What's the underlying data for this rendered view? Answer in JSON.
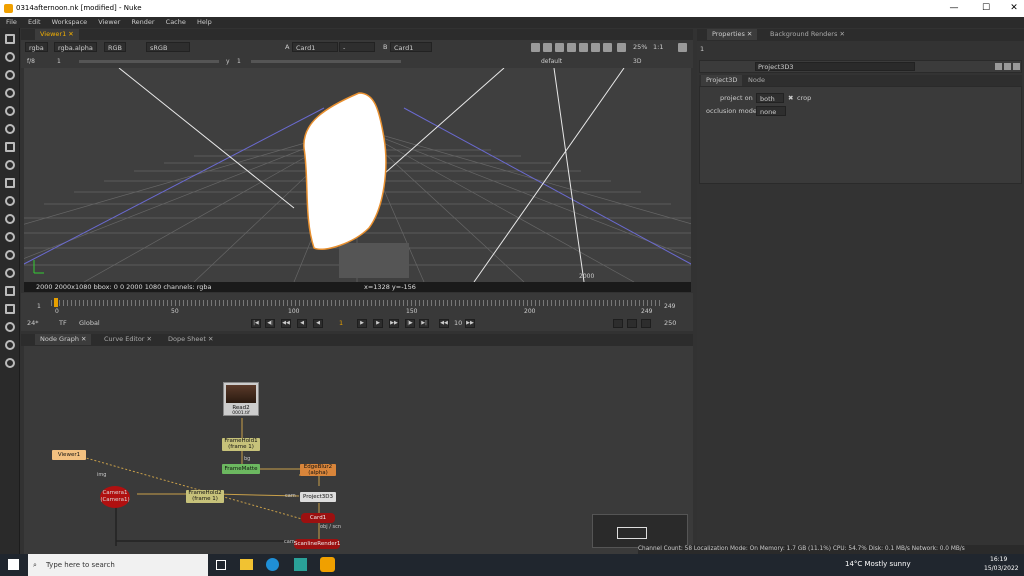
{
  "window": {
    "title": "0314afternoon.nk [modified] - Nuke"
  },
  "menu": [
    "File",
    "Edit",
    "Workspace",
    "Viewer",
    "Render",
    "Cache",
    "Help"
  ],
  "viewer": {
    "tab": "Viewer1",
    "channels": "rgba",
    "alpha": "rgba.alpha",
    "colorspace_a": "RGB",
    "colorspace_b": "sRGB",
    "input_a_label": "A",
    "input_a": "Card1",
    "input_a_op": "-",
    "input_b_label": "B",
    "input_b": "Card1",
    "zoom": "25%",
    "ratio": "1:1",
    "fstop": "f/8",
    "frame": "1",
    "y_label": "y",
    "y_value": "1",
    "camera": "default",
    "mode": "3D",
    "info_left": "2000  2000x1080  bbox: 0 0 2000 1080 channels: rgba",
    "info_coords": "x=1328 y=-156",
    "scene_label": "2000"
  },
  "timeline": {
    "ticks": [
      "0",
      "50",
      "100",
      "150",
      "200",
      "249"
    ],
    "start": "1",
    "end": "249",
    "current": "1",
    "fps": "24*",
    "tf": "TF",
    "global": "Global",
    "step": "10",
    "end_frame": "250"
  },
  "tabs_bottom": [
    "Node Graph",
    "Curve Editor",
    "Dope Sheet"
  ],
  "nodes": {
    "read": "Read2",
    "read_sub": "0001.tif",
    "framehold1": "FrameHold1",
    "framehold1_sub": "(frame 1)",
    "framehold2": "FrameHold2",
    "framehold2_sub": "(frame 1)",
    "blur": "EdgeBlur2",
    "blur_sub": "(alpha)",
    "viewer": "Viewer1",
    "camera": "Camera1",
    "camera_sub": "(Camera1)",
    "project": "Project3D3",
    "card": "Card1",
    "scanline": "ScanlineRender1",
    "matte": "FrameMatte",
    "labels": {
      "cam": "cam",
      "img": "img",
      "bg": "bg",
      "obj": "obj / scn",
      "cam2": "cam"
    }
  },
  "properties": {
    "tab1": "Properties",
    "tab2": "Background Renders",
    "count": "1",
    "node_name": "Project3D3",
    "subtabs": [
      "Project3D",
      "Node"
    ],
    "project_on_label": "project on",
    "project_on_value": "both",
    "crop_label": "crop",
    "occlusion_label": "occlusion mode",
    "occlusion_value": "none"
  },
  "status": "Channel Count: 58  Localization Mode: On  Memory: 1.7 GB (11.1%)  CPU: 54.7%  Disk: 0.1 MB/s  Network: 0.0 MB/s",
  "taskbar": {
    "search": "Type here to search",
    "weather": "14°C  Mostly sunny",
    "time": "16:19",
    "date": "15/03/2022"
  }
}
